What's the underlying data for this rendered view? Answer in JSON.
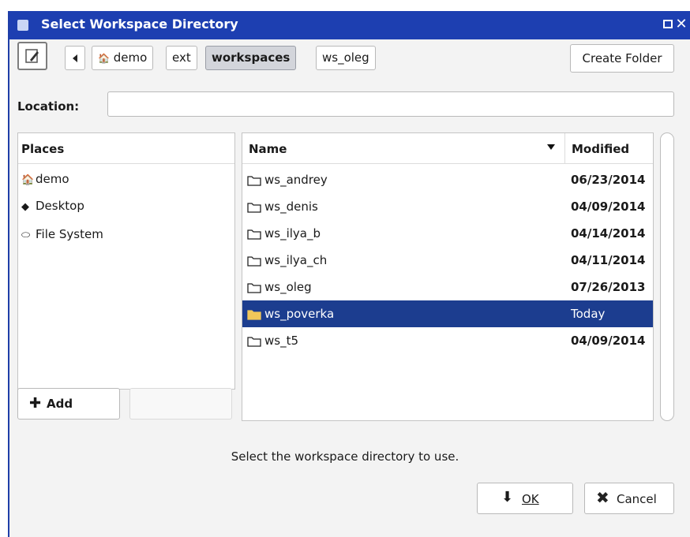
{
  "window": {
    "title": "Select Workspace Directory"
  },
  "toolbar": {
    "breadcrumbs": [
      "demo",
      "ext",
      "workspaces",
      "ws_oleg"
    ],
    "active_crumb": "workspaces",
    "create_folder_label": "Create Folder"
  },
  "location": {
    "label": "Location:",
    "value": ""
  },
  "places": {
    "header": "Places",
    "items": [
      {
        "label": "demo",
        "icon": "home-icon"
      },
      {
        "label": "Desktop",
        "icon": "desktop-icon"
      },
      {
        "label": "File System",
        "icon": "drive-icon"
      }
    ],
    "add_label": "Add",
    "remove_label": ""
  },
  "files": {
    "name_header": "Name",
    "modified_header": "Modified",
    "sort_icon": "sort-descending-icon",
    "rows": [
      {
        "name": "ws_andrey",
        "modified": "06/23/2014",
        "selected": false
      },
      {
        "name": "ws_denis",
        "modified": "04/09/2014",
        "selected": false
      },
      {
        "name": "ws_ilya_b",
        "modified": "04/14/2014",
        "selected": false
      },
      {
        "name": "ws_ilya_ch",
        "modified": "04/11/2014",
        "selected": false
      },
      {
        "name": "ws_oleg",
        "modified": "07/26/2013",
        "selected": false
      },
      {
        "name": "ws_poverka",
        "modified": "Today",
        "selected": true
      },
      {
        "name": "ws_t5",
        "modified": "04/09/2014",
        "selected": false
      }
    ]
  },
  "hint": "Select the workspace directory to use.",
  "actions": {
    "ok_label": "OK",
    "cancel_label": "Cancel"
  },
  "colors": {
    "titlebar": "#1d3fb1",
    "selection": "#1c3d8f",
    "window_bg": "#f3f3f3"
  }
}
